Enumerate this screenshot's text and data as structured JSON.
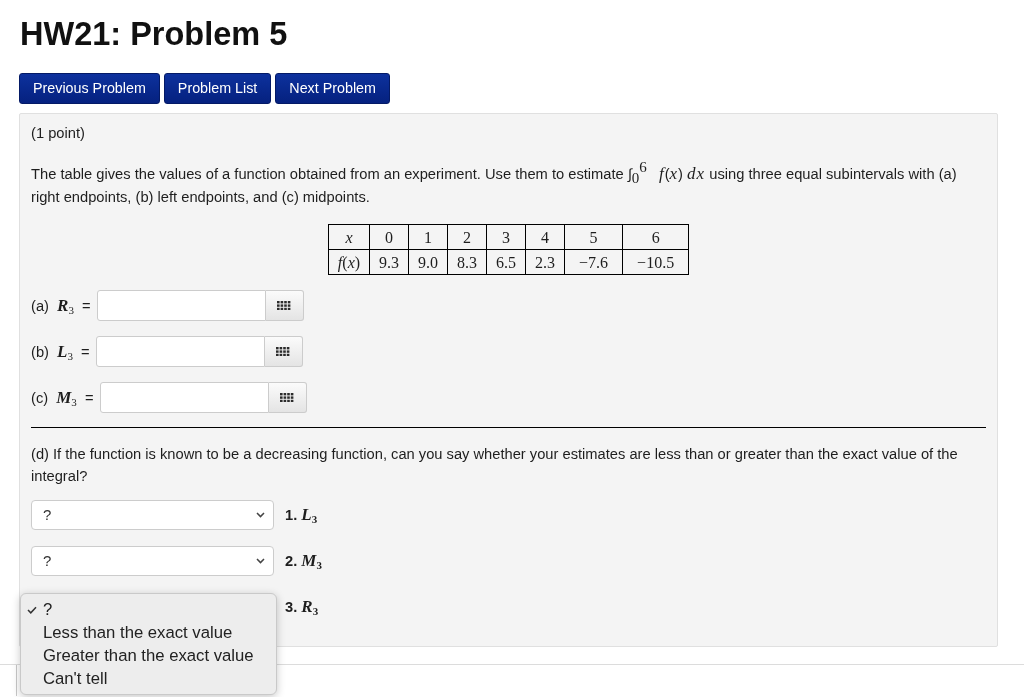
{
  "title": "HW21: Problem 5",
  "nav_buttons": [
    "Previous Problem",
    "Problem List",
    "Next Problem"
  ],
  "problem": {
    "points": "(1 point)",
    "statement": "The table gives the values of a function obtained from an experiment. Use them to estimate ∫$_{0}$$^{6}$ *f*(*x*) *dx* using three equal subintervals with (a) right endpoints, (b) left endpoints, and (c) midpoints.",
    "table": {
      "rows": [
        [
          "*x*",
          "0",
          "1",
          "2",
          "3",
          "4",
          "5",
          "6"
        ],
        [
          "*f*(*x*)",
          "9.3",
          "9.0",
          "8.3",
          "6.5",
          "2.3",
          "−7.6",
          "−10.5"
        ]
      ]
    },
    "answers": [
      {
        "label": "(a) *R*$_{3}$ ="
      },
      {
        "label": "(b) *L*$_{3}$ ="
      },
      {
        "label": "(c) *M*$_{3}$ ="
      }
    ],
    "question": "(d) If the function is known to be a decreasing function, can you say whether your estimates are less than or greater than the exact value of the integral?",
    "dropdowns": [
      {
        "value": "?",
        "open": false,
        "label": "1. *L*$_{3}$"
      },
      {
        "value": "?",
        "open": false,
        "label": "2. *M*$_{3}$"
      },
      {
        "open": true,
        "label": "3. *R*$_{3}$",
        "options": [
          {
            "text": "?",
            "selected": true
          },
          {
            "text": "Less than the exact value",
            "selected": false
          },
          {
            "text": "Greater than the exact value",
            "selected": false
          },
          {
            "text": "Can't tell",
            "selected": false
          }
        ]
      }
    ]
  }
}
